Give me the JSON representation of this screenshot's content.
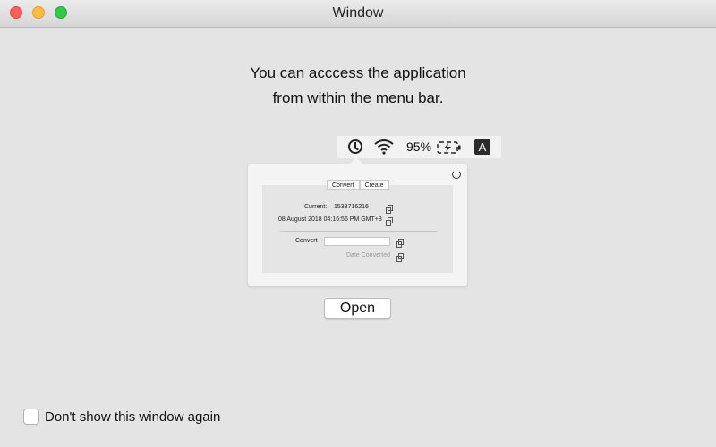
{
  "window": {
    "title": "Window"
  },
  "headline": {
    "line1": "You can acccess the application",
    "line2": "from within the menu bar."
  },
  "menubar": {
    "battery_percent": "95%",
    "input_source": "A",
    "icons": [
      "clock-icon",
      "wifi-icon",
      "battery-charging-icon"
    ]
  },
  "popover": {
    "tabs": [
      "Convert",
      "Create"
    ],
    "current_label": "Current:",
    "current_value": "1533716216",
    "date_value": "08 August 2018 04:16:56 PM GMT+8",
    "convert_label": "Convert",
    "convert_input": "",
    "date_converted_placeholder": "Date Converted"
  },
  "open_button": "Open",
  "dont_show_label": "Don't show this window again"
}
